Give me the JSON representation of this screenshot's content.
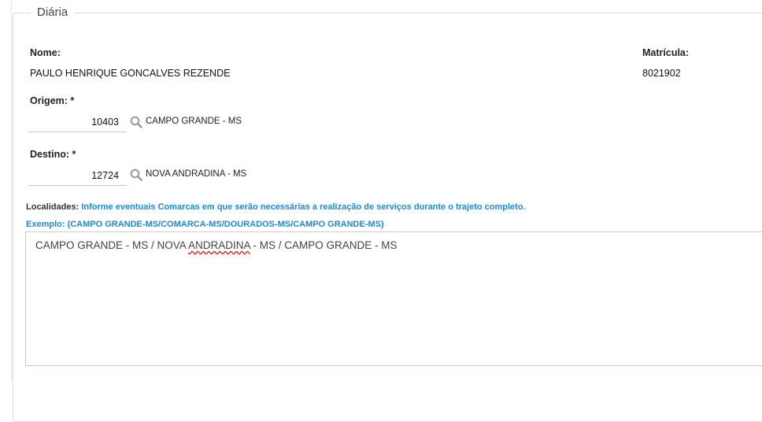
{
  "form": {
    "legend": "Diária",
    "nome": {
      "label": "Nome:",
      "value": "PAULO HENRIQUE GONCALVES REZENDE"
    },
    "matricula": {
      "label": "Matrícula:",
      "value": "8021902"
    },
    "origem": {
      "label": "Origem: *",
      "code": "10403",
      "city": "CAMPO GRANDE - MS"
    },
    "destino": {
      "label": "Destino: *",
      "code": "12724",
      "city": "NOVA ANDRADINA - MS"
    },
    "localidades": {
      "label": "Localidades:",
      "hint": "Informe eventuais Comarcas em que serão necessárias a realização de serviços durante o trajeto completo.",
      "example": "Exemplo: (CAMPO GRANDE-MS/COMARCA-MS/DOURADOS-MS/CAMPO GRANDE-MS)",
      "value_before": "CAMPO GRANDE - MS / NOVA ",
      "value_misspelled": "ANDRADINA",
      "value_after": " - MS / CAMPO GRANDE - MS"
    }
  },
  "icons": {
    "search": "search-icon",
    "search_color": "#9a9a9a"
  },
  "colors": {
    "hint_blue": "#1d8ad1"
  }
}
